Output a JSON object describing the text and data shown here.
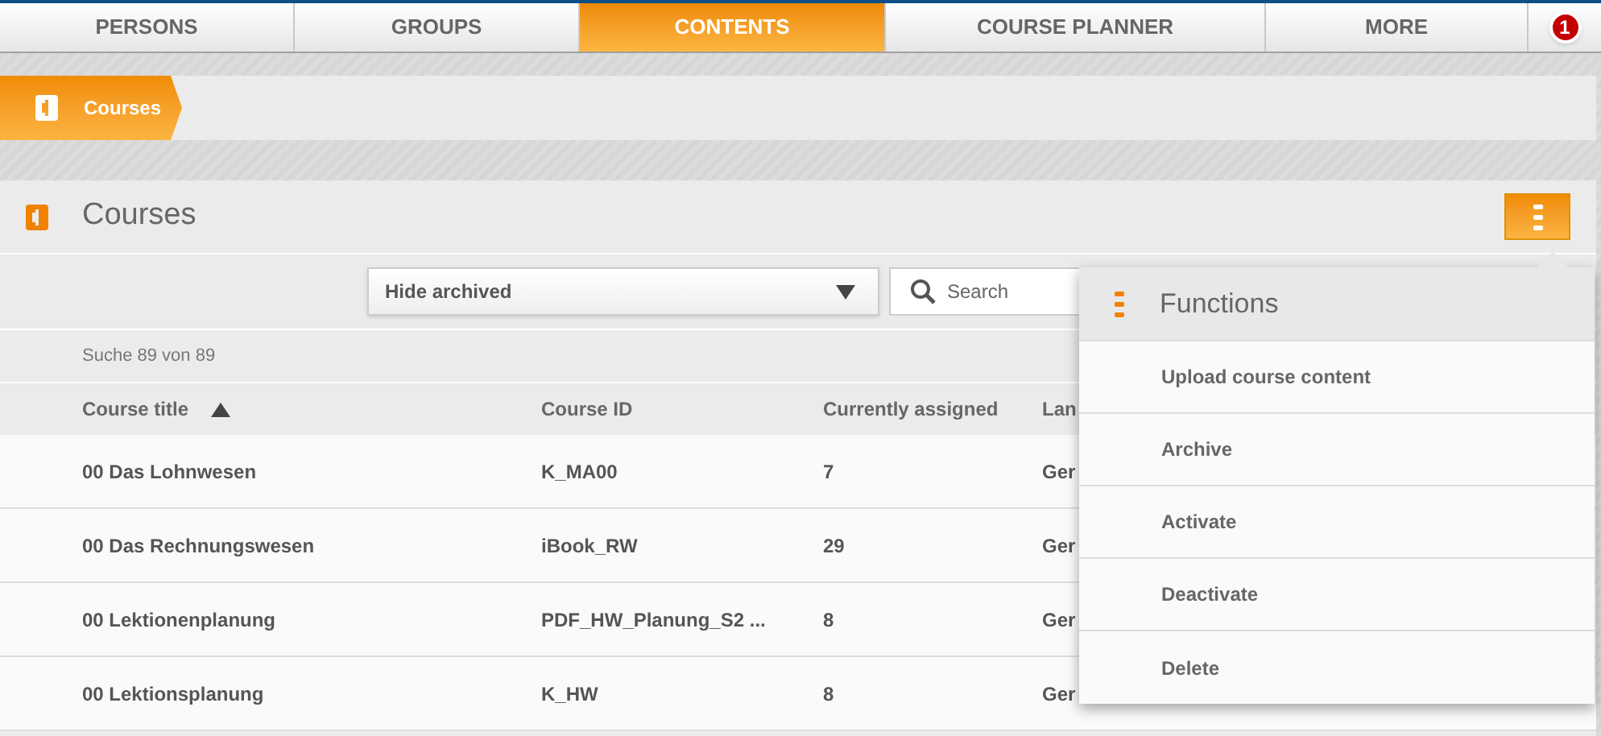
{
  "nav": {
    "tabs": [
      {
        "label": "PERSONS",
        "selected": false
      },
      {
        "label": "GROUPS",
        "selected": false
      },
      {
        "label": "CONTENTS",
        "selected": true
      },
      {
        "label": "COURSE PLANNER",
        "selected": false
      },
      {
        "label": "MORE",
        "selected": false
      }
    ],
    "notification_count": "1"
  },
  "breadcrumb": {
    "label": "Courses"
  },
  "panel": {
    "title": "Courses",
    "filter": {
      "value": "Hide archived"
    },
    "search": {
      "placeholder": "Search"
    },
    "result_count": "Suche 89 von 89",
    "table": {
      "columns": [
        {
          "label": "Course title",
          "sorted": true
        },
        {
          "label": "Course ID",
          "sorted": false
        },
        {
          "label": "Currently assigned",
          "sorted": false
        },
        {
          "label": "Lan",
          "sorted": false
        }
      ],
      "rows": [
        [
          "00 Das Lohnwesen",
          "K_MA00",
          "7",
          "Ger"
        ],
        [
          "00 Das Rechnungswesen",
          "iBook_RW",
          "29",
          "Ger"
        ],
        [
          "00 Lektionenplanung",
          "PDF_HW_Planung_S2 ...",
          "8",
          "Ger"
        ],
        [
          "00 Lektionsplanung",
          "K_HW",
          "8",
          "Ger"
        ]
      ]
    }
  },
  "functions_menu": {
    "title": "Functions",
    "items": [
      "Upload course content",
      "Archive",
      "Activate",
      "Deactivate",
      "Delete"
    ]
  }
}
